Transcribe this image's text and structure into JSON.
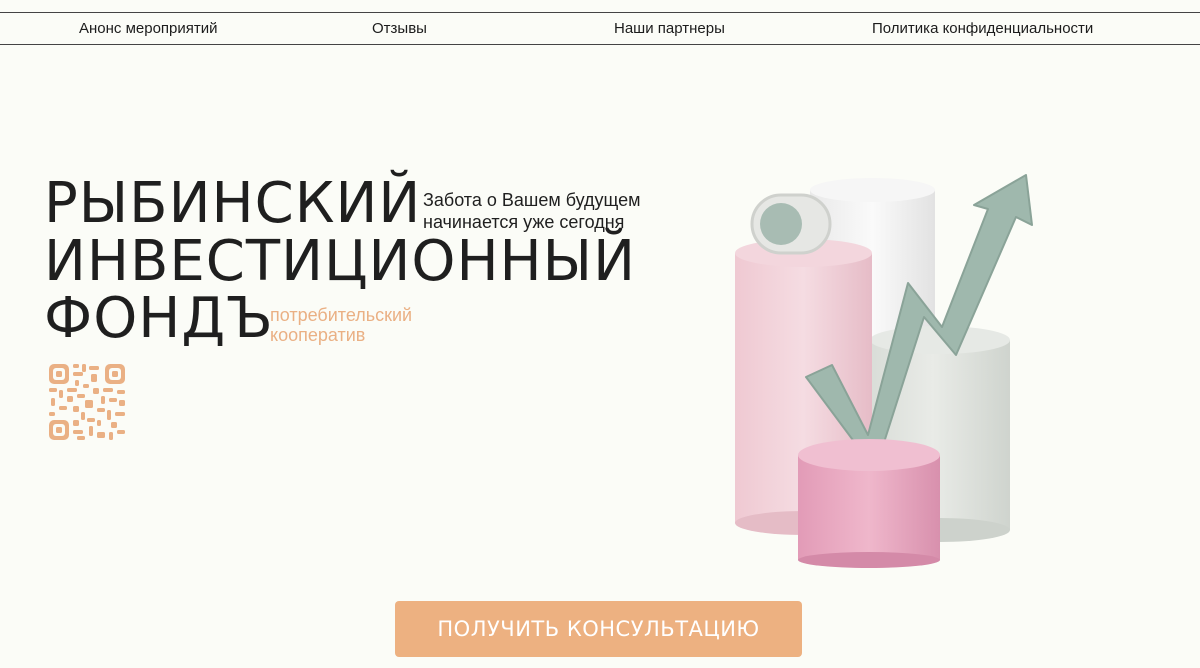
{
  "nav": {
    "items": [
      "Анонс мероприятий",
      "Отзывы",
      "Наши партнеры",
      "Политика конфиденциальности"
    ]
  },
  "hero": {
    "title_lines": [
      "РЫБИНСКИЙ",
      "ИНВЕСТИЦИОННЫЙ",
      "ФОНДЪ"
    ],
    "tagline_lines": [
      "Забота о Вашем будущем",
      "начинается уже сегодня"
    ],
    "subtitle_lines": [
      "потребительский",
      "кооператив"
    ],
    "image_icon": "growth-chart-cylinders-illustration",
    "qr_icon": "qr-code-icon"
  },
  "cta": {
    "label": "ПОЛУЧИТЬ КОНСУЛЬТАЦИЮ"
  },
  "colors": {
    "background": "#fbfcf7",
    "accent": "#edb181",
    "accent_text": "#eab084",
    "text": "#1f1f1f",
    "pink": "#ecc7cf",
    "hot_pink": "#e6a4bd",
    "sage": "#9fb8ad",
    "white_cylinder": "#efefef",
    "gray_cylinder": "#d7dcd6"
  }
}
